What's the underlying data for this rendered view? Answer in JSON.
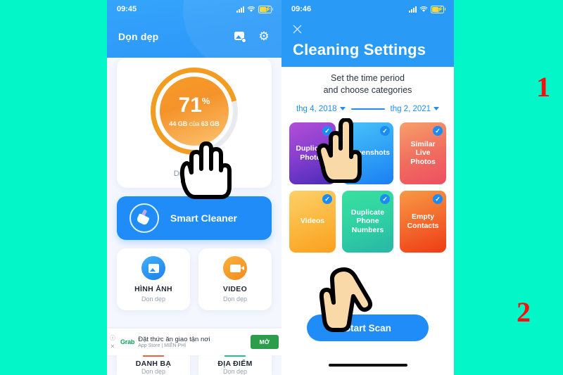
{
  "background_color": "#03F6C8",
  "left_phone": {
    "status_bar": {
      "time": "09:45",
      "signal_icon": "signal-bars-icon",
      "wifi_icon": "wifi-icon",
      "battery_icon": "battery-charging-icon"
    },
    "app_bar": {
      "title": "Dọn dẹp",
      "photo_icon": "photo-manager-icon",
      "settings_icon": "gear-icon"
    },
    "storage": {
      "percent": "71",
      "percent_symbol": "%",
      "used": "44 GB",
      "separator": " của ",
      "total": "63 GB",
      "label": "Dung lượng",
      "ring_color": "#F39C22",
      "ring_track_color": "#E9EAEE"
    },
    "smart_cleaner": {
      "label": "Smart Cleaner",
      "icon": "broom-icon",
      "color": "#1F8CF8"
    },
    "tiles": [
      {
        "title": "HÌNH ẢNH",
        "subtitle": "Dọn dẹp",
        "icon": "image-icon",
        "color": "#1E7FEB"
      },
      {
        "title": "VIDEO",
        "subtitle": "Dọn dẹp",
        "icon": "video-camera-icon",
        "color": "#F28C1E"
      }
    ],
    "ad": {
      "info_icon": "info-icon",
      "close_icon": "close-icon",
      "brand": "Grab",
      "headline": "Đặt thức ăn giao tận nơi",
      "source": "App Store",
      "price": "| MIỄN PHÍ",
      "cta": "MỞ",
      "cta_color": "#2C9E4B"
    },
    "bottom_tiles": [
      {
        "title": "DANH BẠ",
        "subtitle": "Dọn dẹp",
        "cap_color": "#F4603E"
      },
      {
        "title": "ĐỊA ĐIỂM",
        "subtitle": "Dọn dẹp",
        "cap_color": "#22C58B"
      }
    ]
  },
  "right_phone": {
    "status_bar": {
      "time": "09:46",
      "signal_icon": "signal-bars-icon",
      "wifi_icon": "wifi-icon",
      "battery_icon": "battery-charging-icon"
    },
    "header": {
      "close_icon": "close-icon",
      "title": "Cleaning Settings",
      "color": "#299BF7"
    },
    "lead_line1": "Set the time period",
    "lead_line2": "and choose categories",
    "date_range": {
      "from": "thg 4, 2018",
      "to": "thg 2, 2021",
      "caret_icon": "chevron-down-icon"
    },
    "categories": [
      {
        "label": "Duplicate Photos",
        "checked": "✓"
      },
      {
        "label": "Screenshots",
        "checked": "✓"
      },
      {
        "label": "Similar Live Photos",
        "checked": "✓"
      },
      {
        "label": "Videos",
        "checked": "✓"
      },
      {
        "label": "Duplicate Phone Numbers",
        "checked": "✓"
      },
      {
        "label": "Empty Contacts",
        "checked": "✓"
      }
    ],
    "start_scan": {
      "label": "Start Scan",
      "color": "#1F8CF8"
    },
    "home_indicator": "home-bar"
  },
  "annotations": {
    "step_1": "1",
    "step_2": "2",
    "color": "#F70F0F",
    "hand_left": "pointing-hand-cursor",
    "hand_category": "pointing-hand-cursor",
    "hand_scan": "pointing-hand-cursor"
  }
}
